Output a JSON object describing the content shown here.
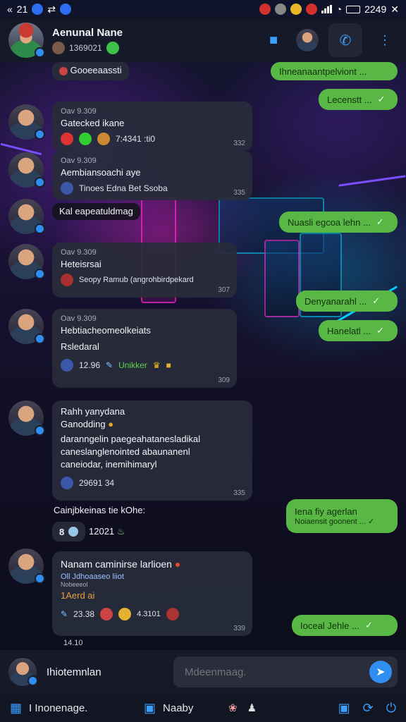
{
  "status_bar": {
    "time_left": "21",
    "clock": "2249"
  },
  "header": {
    "name": "Aenunal Nane",
    "subtitle": "1369021"
  },
  "messages": {
    "top_chip": "Gooeeaassti",
    "out1": "Ihneanaantpelviont ...",
    "out2": "Lecenstt ...",
    "m1": {
      "time": "Oav 9.309",
      "title": "Gatecked ikane",
      "row_text": "7:4341 :ti0",
      "stamp": "332"
    },
    "m2": {
      "time": "Oav 9.309",
      "title": "Aembiansoachi aye",
      "row_text": "Tinoes Edna Bet Ssoba",
      "stamp": "335"
    },
    "tag1": "Kal eapeatuldmag",
    "out3": "Nuasli egcoa lehn ...",
    "m3": {
      "time": "Oav 9.309",
      "title": "Heteisrsai",
      "row_text": "Seopy Ramub (angrohbirdpekard",
      "stamp": "307"
    },
    "out4": "Denyanarahl ...",
    "out5": "Hanelatl ...",
    "m4": {
      "time": "Oav 9.309",
      "line1": "Hebtiacheomeolkeiats",
      "line2": "Rsledaral",
      "row_text": "12.96",
      "green": "Unikker",
      "stamp": "309"
    },
    "m5": {
      "line1": "Rahh yanydana",
      "line2": "Ganodding",
      "line3": "daranngelin paegeahatanesladikal",
      "line4": "caneslanglenointed abaunanenl",
      "line5": "caneiodar, inemihimaryl",
      "row_text": "29691 34",
      "stamp": "335"
    },
    "label1": "Cainjbkeinas tie kOhe:",
    "out6_line1": "Iena fiy agerlan",
    "out6_line2": "Noiaensit goonent ...",
    "chip2": "8",
    "chip2_text": "12021",
    "m6": {
      "title": "Nanam caminirse larlioen",
      "line2": "Oll Jdhoaaseo liiot",
      "line3": "Nobeeeol",
      "line4": "1Aerd ai",
      "row_text": "23.38",
      "row_text2": "4.3101",
      "stamp": "339"
    },
    "out7": "Ioceal Jehle ...",
    "footer_time": "14.10"
  },
  "composer": {
    "name": "Ihiotemnlan",
    "placeholder": "Mdeenmaag."
  },
  "bottom_bar": {
    "left_label": "I Inonenage.",
    "mid_label": "Naaby"
  }
}
